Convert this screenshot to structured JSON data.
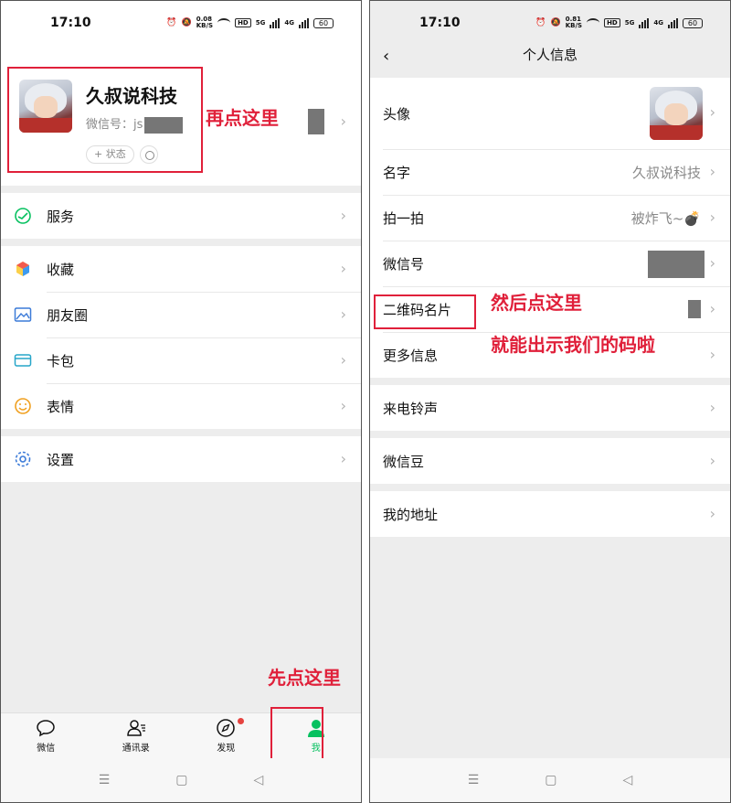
{
  "left": {
    "status": {
      "time": "17:10",
      "speed": "0.08",
      "speed_unit": "KB/S",
      "net1": "5G",
      "net2": "4G",
      "battery": "60"
    },
    "profile": {
      "name": "久叔说科技",
      "wxid_label": "微信号：js",
      "status_label": "+ 状态"
    },
    "menu_groups": [
      [
        {
          "label": "服务",
          "icon": "service-icon"
        }
      ],
      [
        {
          "label": "收藏",
          "icon": "favorites-icon"
        },
        {
          "label": "朋友圈",
          "icon": "moments-icon"
        },
        {
          "label": "卡包",
          "icon": "card-wallet-icon"
        },
        {
          "label": "表情",
          "icon": "sticker-icon"
        }
      ],
      [
        {
          "label": "设置",
          "icon": "settings-icon"
        }
      ]
    ],
    "tabs": [
      {
        "label": "微信",
        "icon": "chat-icon"
      },
      {
        "label": "通讯录",
        "icon": "contacts-icon"
      },
      {
        "label": "发现",
        "icon": "discover-icon"
      },
      {
        "label": "我",
        "icon": "me-icon"
      }
    ],
    "annotations": {
      "step2": "再点这里",
      "step1": "先点这里"
    }
  },
  "right": {
    "status": {
      "time": "17:10",
      "speed": "0.81",
      "speed_unit": "KB/S",
      "net1": "5G",
      "net2": "4G",
      "battery": "60"
    },
    "title": "个人信息",
    "rows_group1": [
      {
        "label": "头像",
        "value": ""
      },
      {
        "label": "名字",
        "value": "久叔说科技"
      },
      {
        "label": "拍一拍",
        "value": "被炸飞~💣"
      },
      {
        "label": "微信号",
        "value": ""
      },
      {
        "label": "二维码名片",
        "value": ""
      },
      {
        "label": "更多信息",
        "value": ""
      }
    ],
    "rows_group2": [
      {
        "label": "来电铃声"
      }
    ],
    "rows_group3": [
      {
        "label": "微信豆"
      }
    ],
    "rows_group4": [
      {
        "label": "我的地址"
      }
    ],
    "annotations": {
      "line1": "然后点这里",
      "line2": "就能出示我们的码啦"
    }
  },
  "colors": {
    "accent_green": "#07c160",
    "annotation_red": "#e0203a"
  }
}
